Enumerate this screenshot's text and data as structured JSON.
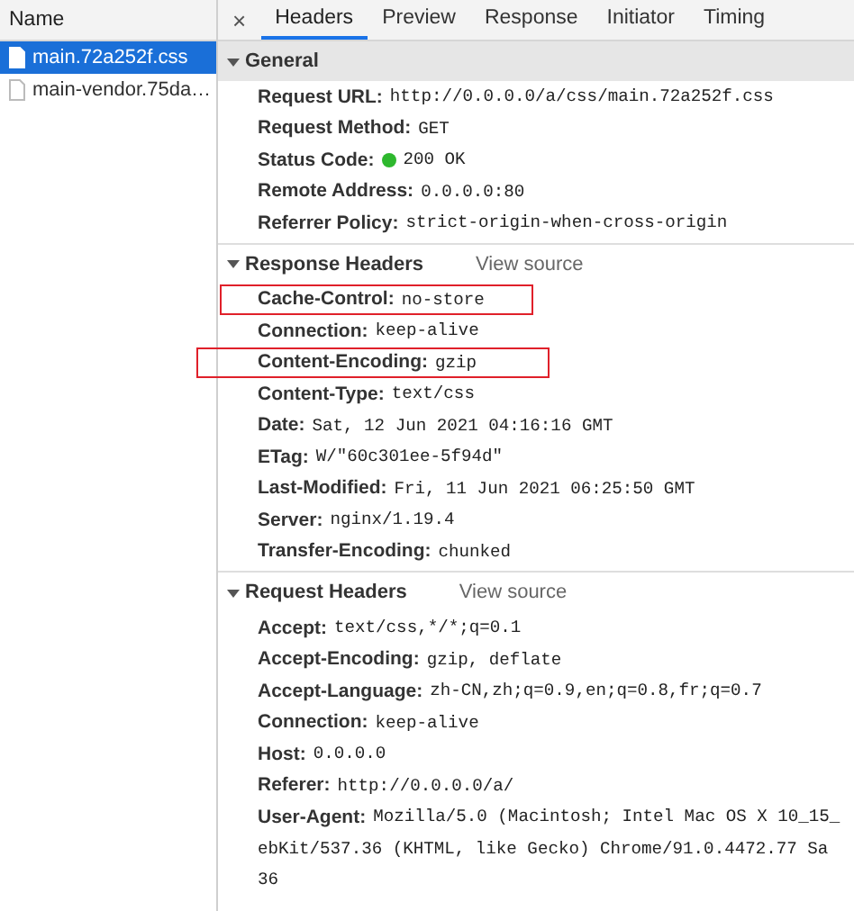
{
  "file_list": {
    "column": "Name",
    "files": [
      {
        "name": "main.72a252f.css",
        "selected": true
      },
      {
        "name": "main-vendor.75da…",
        "selected": false
      }
    ]
  },
  "close_label": "×",
  "tabs": [
    {
      "label": "Headers",
      "selected": true
    },
    {
      "label": "Preview",
      "selected": false
    },
    {
      "label": "Response",
      "selected": false
    },
    {
      "label": "Initiator",
      "selected": false
    },
    {
      "label": "Timing",
      "selected": false
    }
  ],
  "sections": [
    {
      "kind": "summary",
      "title": "General",
      "expanded": true,
      "rows": [
        {
          "name": "Request URL:",
          "value": "http://0.0.0.0/a/css/main.72a252f.css",
          "highlighted": false
        },
        {
          "name": "Request Method:",
          "value": "GET",
          "highlighted": false
        },
        {
          "name": "Status Code:",
          "value": "200 OK",
          "color": "#2eb82e",
          "highlighted": false
        },
        {
          "name": "Remote Address:",
          "value": "0.0.0.0:80",
          "highlighted": false
        },
        {
          "name": "Referrer Policy:",
          "value": "strict-origin-when-cross-origin",
          "highlighted": false
        }
      ]
    },
    {
      "kind": "headers",
      "title": "Response Headers",
      "link": "View source",
      "expanded": true,
      "rows": [
        {
          "name": "Cache-Control:",
          "value": "no-store",
          "highlighted": true
        },
        {
          "name": "Connection:",
          "value": "keep-alive",
          "highlighted": false
        },
        {
          "name": "Content-Encoding:",
          "value": "gzip",
          "highlighted": true
        },
        {
          "name": "Content-Type:",
          "value": "text/css",
          "highlighted": false
        },
        {
          "name": "Date:",
          "value": "Sat, 12 Jun 2021 04:16:16 GMT",
          "highlighted": false
        },
        {
          "name": "ETag:",
          "value": "W/\"60c301ee-5f94d\"",
          "highlighted": false
        },
        {
          "name": "Last-Modified:",
          "value": "Fri, 11 Jun 2021 06:25:50 GMT",
          "highlighted": false
        },
        {
          "name": "Server:",
          "value": "nginx/1.19.4",
          "highlighted": false
        },
        {
          "name": "Transfer-Encoding:",
          "value": "chunked",
          "highlighted": false
        }
      ]
    },
    {
      "kind": "headers",
      "title": "Request Headers",
      "link": "View source",
      "expanded": true,
      "rows": [
        {
          "name": "Accept:",
          "value": "text/css,*/*;q=0.1",
          "highlighted": false
        },
        {
          "name": "Accept-Encoding:",
          "value": "gzip, deflate",
          "highlighted": false
        },
        {
          "name": "Accept-Language:",
          "value": "zh-CN,zh;q=0.9,en;q=0.8,fr;q=0.7",
          "highlighted": false
        },
        {
          "name": "Connection:",
          "value": "keep-alive",
          "highlighted": false
        },
        {
          "name": "Host:",
          "value": "0.0.0.0",
          "highlighted": false
        },
        {
          "name": "Referer:",
          "value": "http://0.0.0.0/a/",
          "highlighted": false
        },
        {
          "name": "User-Agent:",
          "value": "Mozilla/5.0 (Macintosh; Intel Mac OS X 10_15_",
          "continuation": [
            "ebKit/537.36 (KHTML, like Gecko) Chrome/91.0.4472.77 Sa",
            "36"
          ],
          "highlighted": false
        }
      ]
    }
  ]
}
